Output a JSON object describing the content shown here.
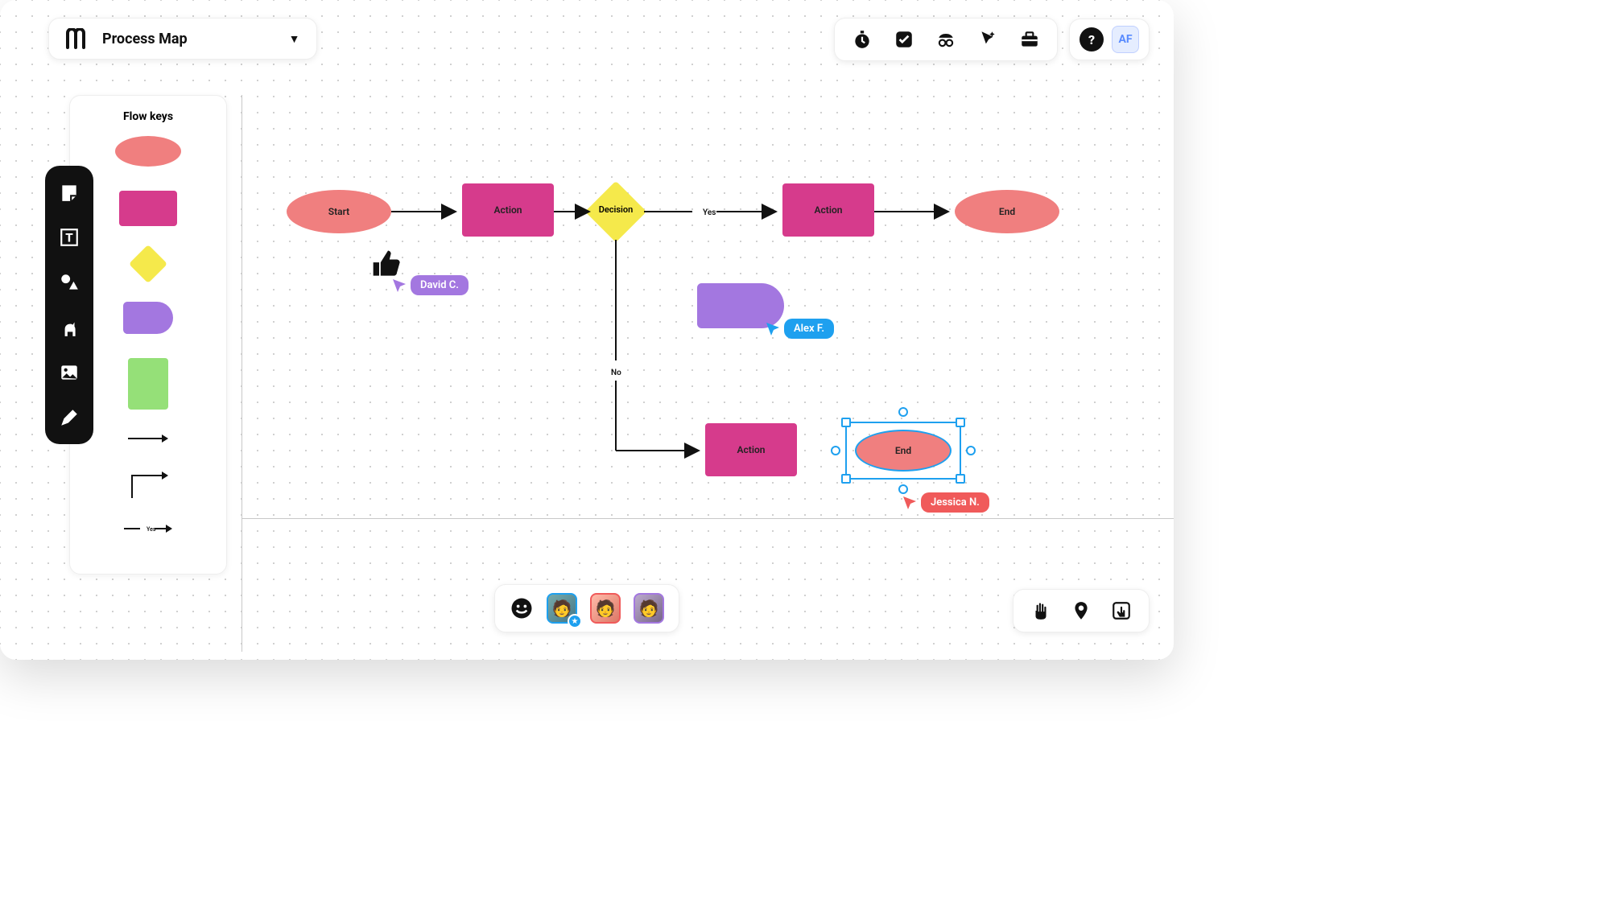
{
  "header": {
    "title": "Process Map"
  },
  "user": {
    "initials": "AF"
  },
  "flowKeys": {
    "title": "Flow keys"
  },
  "nodes": {
    "start": "Start",
    "action1": "Action",
    "decision": "Decision",
    "action2": "Action",
    "end1": "End",
    "action3": "Action",
    "end2": "End"
  },
  "edges": {
    "yes": "Yes",
    "no": "No",
    "yesLabel": "Yes"
  },
  "cursors": {
    "david": "David C.",
    "alex": "Alex F.",
    "jessica": "Jessica N."
  },
  "colors": {
    "ellipse": "#f07f7f",
    "rect": "#d63b8c",
    "diamond": "#f5e94b",
    "tab": "#a377e0",
    "green": "#95e078",
    "selection": "#1ea0ef",
    "david": "#a377e0",
    "alex": "#1ea0ef",
    "jessica": "#f05a5a"
  }
}
